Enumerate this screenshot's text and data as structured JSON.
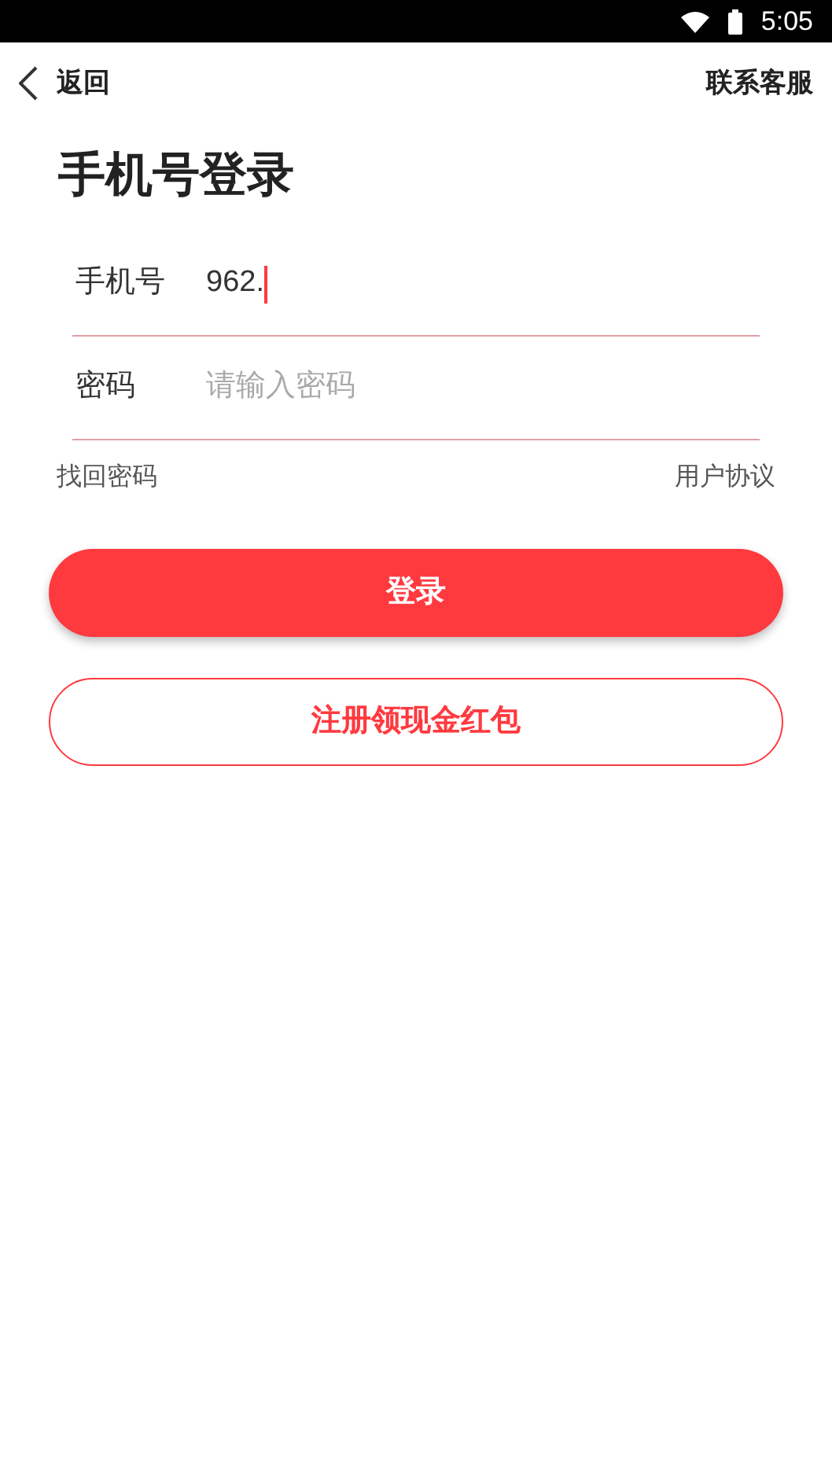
{
  "status_bar": {
    "time": "5:05"
  },
  "header": {
    "back": "返回",
    "contact": "联系客服"
  },
  "title": "手机号登录",
  "fields": [
    {
      "label": "手机号",
      "value": "962."
    },
    {
      "label": "密码",
      "placeholder": "请输入密码"
    }
  ],
  "links": [
    "找回密码",
    "用户协议"
  ],
  "buttons": [
    {
      "kind": "primary",
      "label": "登录"
    },
    {
      "kind": "outline",
      "label": "注册领现金红包"
    }
  ]
}
